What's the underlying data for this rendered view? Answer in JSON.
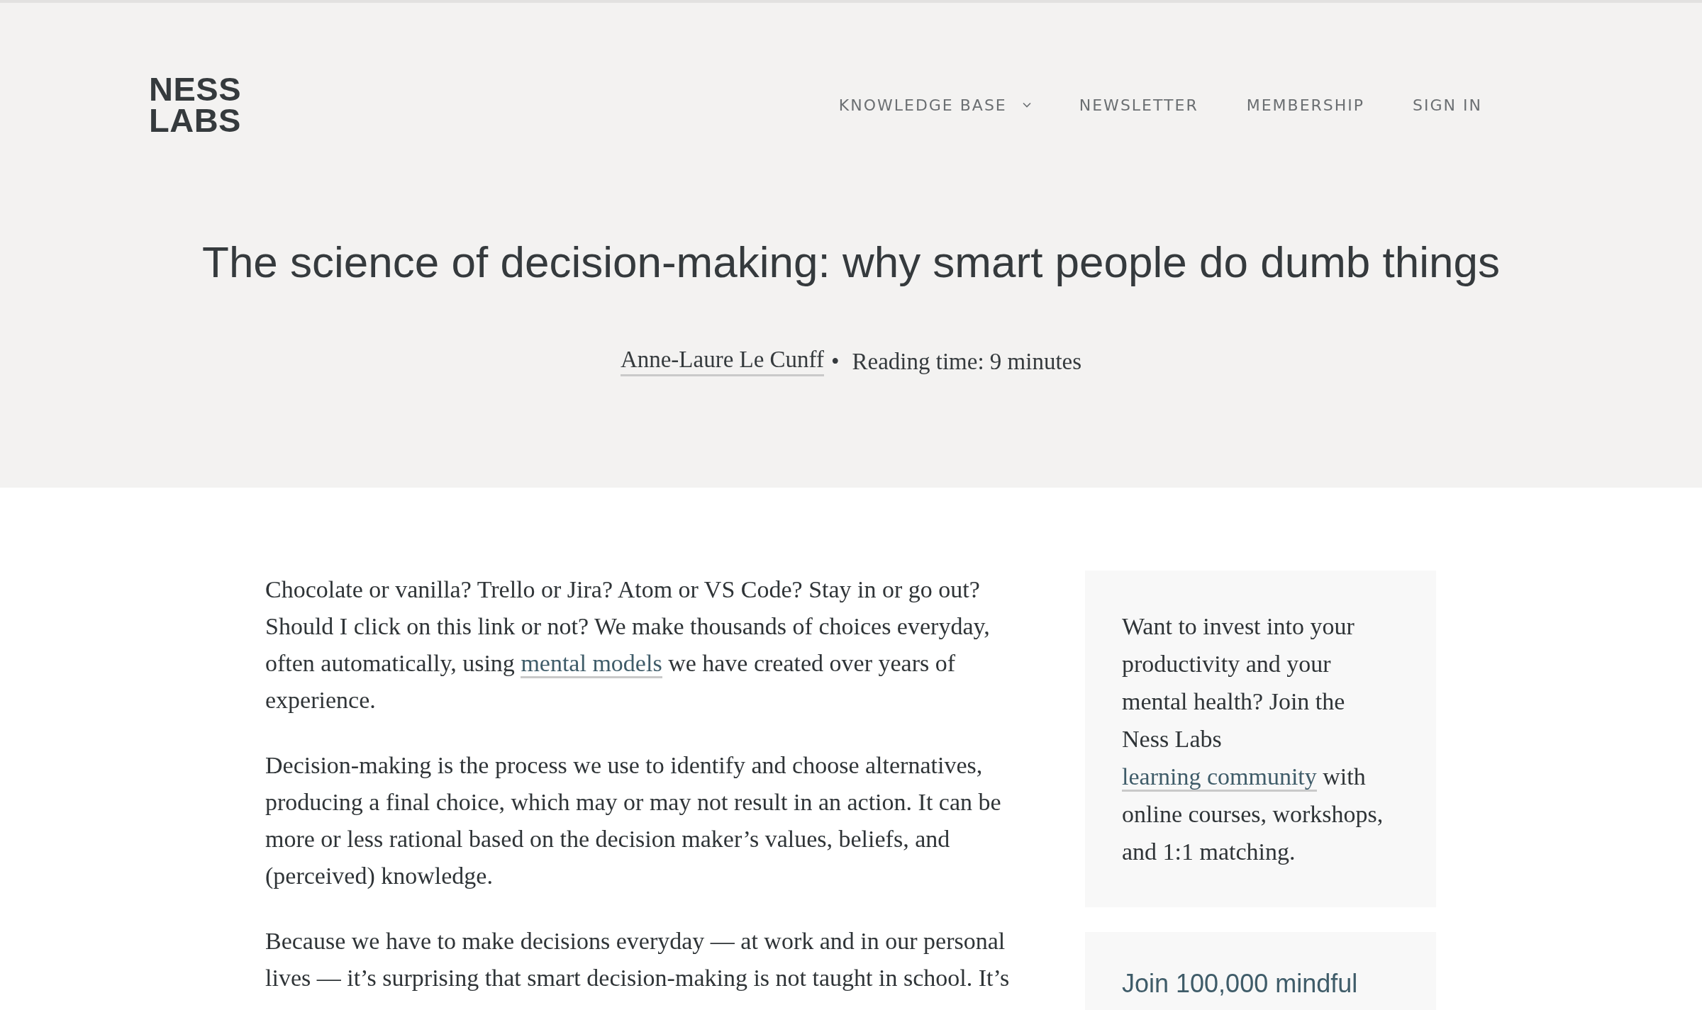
{
  "header": {
    "logo": [
      "NESS",
      "LABS"
    ],
    "nav": [
      {
        "label": "KNOWLEDGE BASE",
        "kind": "dropdown"
      },
      {
        "label": "NEWSLETTER",
        "kind": "link"
      },
      {
        "label": "MEMBERSHIP",
        "kind": "link"
      },
      {
        "label": "SIGN IN",
        "kind": "link"
      }
    ]
  },
  "article": {
    "title": "The science of decision-making: why smart people do dumb things",
    "author": "Anne-Laure Le Cunff",
    "separator": "•",
    "reading_time": "Reading time: 9 minutes",
    "paragraphs": [
      [
        {
          "text": "Chocolate or vanilla? Trello or Jira? Atom or VS Code? Stay in or go out? Should I click on this link or not? We make thousands of choices everyday, often automatically, using ",
          "link": false
        },
        {
          "text": "mental models",
          "link": true
        },
        {
          "text": " we have created over years of experience.",
          "link": false
        }
      ],
      [
        {
          "text": "Decision-making is the process we use to identify and choose alternatives, producing a final choice, which may or may not result in an action. It can be more or less rational based on the decision maker’s values, beliefs, and (perceived) knowledge.",
          "link": false
        }
      ],
      [
        {
          "text": "Because we have to make decisions everyday — at work and in our personal lives — it’s surprising that smart decision-making is not taught in school. It’s",
          "link": false
        }
      ]
    ]
  },
  "sidebar": {
    "promo": [
      {
        "text": "Want to invest into your productivity and your mental health? Join the Ness Labs ",
        "link": false
      },
      {
        "text": "learning community",
        "link": true
      },
      {
        "text": " with online courses, workshops, and 1:1 matching.",
        "link": false
      }
    ],
    "newsletter_heading": "Join 100,000 mindful"
  }
}
